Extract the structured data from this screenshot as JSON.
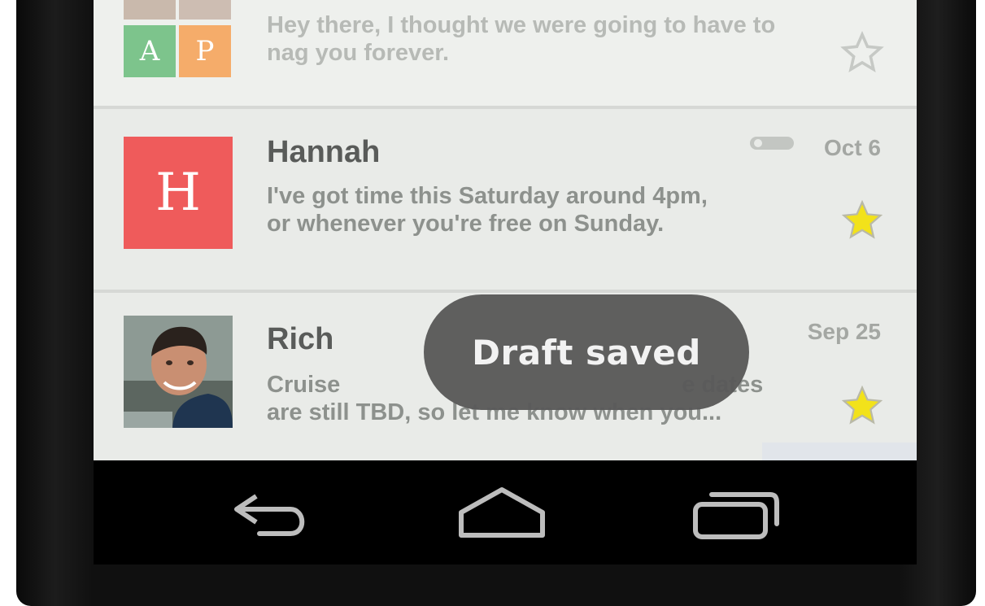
{
  "emails": [
    {
      "avatar_letters": [
        "A",
        "P"
      ],
      "avatar_colors": [
        "#7dc48c",
        "#f5ac6a"
      ],
      "snippet": "Hey there, I thought we were going to have to nag you forever.",
      "starred": false
    },
    {
      "sender": "Hannah",
      "avatar_letter": "H",
      "avatar_color": "#ef5b5b",
      "date": "Oct 6",
      "snippet_line1": "I've got time this Saturday around 4pm,",
      "snippet_line2": "or  whenever you're free on Sunday.",
      "starred": true,
      "has_attachment_icon": "label-icon"
    },
    {
      "sender": "Rich",
      "avatar": "photo-avatar",
      "date": "Sep 25",
      "snippet_line1": "Cruise",
      "snippet_line1_end": "e dates",
      "snippet_line2": "are still TBD, so let me know when you...",
      "starred": true
    }
  ],
  "toast": {
    "text": "Draft saved"
  },
  "navigation": {
    "buttons": [
      "back-icon",
      "home-icon",
      "recents-icon"
    ]
  },
  "colors": {
    "star_filled": "#f2e21a",
    "toast_bg": "#585858"
  }
}
